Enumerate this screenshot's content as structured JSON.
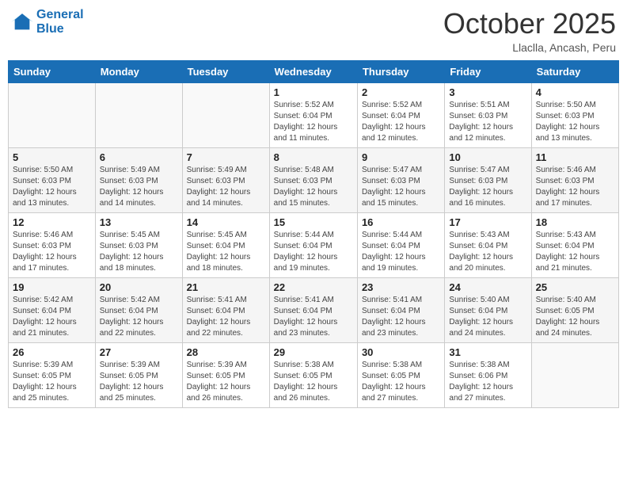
{
  "header": {
    "logo_line1": "General",
    "logo_line2": "Blue",
    "month": "October 2025",
    "location": "Llaclla, Ancash, Peru"
  },
  "weekdays": [
    "Sunday",
    "Monday",
    "Tuesday",
    "Wednesday",
    "Thursday",
    "Friday",
    "Saturday"
  ],
  "weeks": [
    [
      {
        "day": "",
        "info": ""
      },
      {
        "day": "",
        "info": ""
      },
      {
        "day": "",
        "info": ""
      },
      {
        "day": "1",
        "info": "Sunrise: 5:52 AM\nSunset: 6:04 PM\nDaylight: 12 hours\nand 11 minutes."
      },
      {
        "day": "2",
        "info": "Sunrise: 5:52 AM\nSunset: 6:04 PM\nDaylight: 12 hours\nand 12 minutes."
      },
      {
        "day": "3",
        "info": "Sunrise: 5:51 AM\nSunset: 6:03 PM\nDaylight: 12 hours\nand 12 minutes."
      },
      {
        "day": "4",
        "info": "Sunrise: 5:50 AM\nSunset: 6:03 PM\nDaylight: 12 hours\nand 13 minutes."
      }
    ],
    [
      {
        "day": "5",
        "info": "Sunrise: 5:50 AM\nSunset: 6:03 PM\nDaylight: 12 hours\nand 13 minutes."
      },
      {
        "day": "6",
        "info": "Sunrise: 5:49 AM\nSunset: 6:03 PM\nDaylight: 12 hours\nand 14 minutes."
      },
      {
        "day": "7",
        "info": "Sunrise: 5:49 AM\nSunset: 6:03 PM\nDaylight: 12 hours\nand 14 minutes."
      },
      {
        "day": "8",
        "info": "Sunrise: 5:48 AM\nSunset: 6:03 PM\nDaylight: 12 hours\nand 15 minutes."
      },
      {
        "day": "9",
        "info": "Sunrise: 5:47 AM\nSunset: 6:03 PM\nDaylight: 12 hours\nand 15 minutes."
      },
      {
        "day": "10",
        "info": "Sunrise: 5:47 AM\nSunset: 6:03 PM\nDaylight: 12 hours\nand 16 minutes."
      },
      {
        "day": "11",
        "info": "Sunrise: 5:46 AM\nSunset: 6:03 PM\nDaylight: 12 hours\nand 17 minutes."
      }
    ],
    [
      {
        "day": "12",
        "info": "Sunrise: 5:46 AM\nSunset: 6:03 PM\nDaylight: 12 hours\nand 17 minutes."
      },
      {
        "day": "13",
        "info": "Sunrise: 5:45 AM\nSunset: 6:03 PM\nDaylight: 12 hours\nand 18 minutes."
      },
      {
        "day": "14",
        "info": "Sunrise: 5:45 AM\nSunset: 6:04 PM\nDaylight: 12 hours\nand 18 minutes."
      },
      {
        "day": "15",
        "info": "Sunrise: 5:44 AM\nSunset: 6:04 PM\nDaylight: 12 hours\nand 19 minutes."
      },
      {
        "day": "16",
        "info": "Sunrise: 5:44 AM\nSunset: 6:04 PM\nDaylight: 12 hours\nand 19 minutes."
      },
      {
        "day": "17",
        "info": "Sunrise: 5:43 AM\nSunset: 6:04 PM\nDaylight: 12 hours\nand 20 minutes."
      },
      {
        "day": "18",
        "info": "Sunrise: 5:43 AM\nSunset: 6:04 PM\nDaylight: 12 hours\nand 21 minutes."
      }
    ],
    [
      {
        "day": "19",
        "info": "Sunrise: 5:42 AM\nSunset: 6:04 PM\nDaylight: 12 hours\nand 21 minutes."
      },
      {
        "day": "20",
        "info": "Sunrise: 5:42 AM\nSunset: 6:04 PM\nDaylight: 12 hours\nand 22 minutes."
      },
      {
        "day": "21",
        "info": "Sunrise: 5:41 AM\nSunset: 6:04 PM\nDaylight: 12 hours\nand 22 minutes."
      },
      {
        "day": "22",
        "info": "Sunrise: 5:41 AM\nSunset: 6:04 PM\nDaylight: 12 hours\nand 23 minutes."
      },
      {
        "day": "23",
        "info": "Sunrise: 5:41 AM\nSunset: 6:04 PM\nDaylight: 12 hours\nand 23 minutes."
      },
      {
        "day": "24",
        "info": "Sunrise: 5:40 AM\nSunset: 6:04 PM\nDaylight: 12 hours\nand 24 minutes."
      },
      {
        "day": "25",
        "info": "Sunrise: 5:40 AM\nSunset: 6:05 PM\nDaylight: 12 hours\nand 24 minutes."
      }
    ],
    [
      {
        "day": "26",
        "info": "Sunrise: 5:39 AM\nSunset: 6:05 PM\nDaylight: 12 hours\nand 25 minutes."
      },
      {
        "day": "27",
        "info": "Sunrise: 5:39 AM\nSunset: 6:05 PM\nDaylight: 12 hours\nand 25 minutes."
      },
      {
        "day": "28",
        "info": "Sunrise: 5:39 AM\nSunset: 6:05 PM\nDaylight: 12 hours\nand 26 minutes."
      },
      {
        "day": "29",
        "info": "Sunrise: 5:38 AM\nSunset: 6:05 PM\nDaylight: 12 hours\nand 26 minutes."
      },
      {
        "day": "30",
        "info": "Sunrise: 5:38 AM\nSunset: 6:05 PM\nDaylight: 12 hours\nand 27 minutes."
      },
      {
        "day": "31",
        "info": "Sunrise: 5:38 AM\nSunset: 6:06 PM\nDaylight: 12 hours\nand 27 minutes."
      },
      {
        "day": "",
        "info": ""
      }
    ]
  ]
}
